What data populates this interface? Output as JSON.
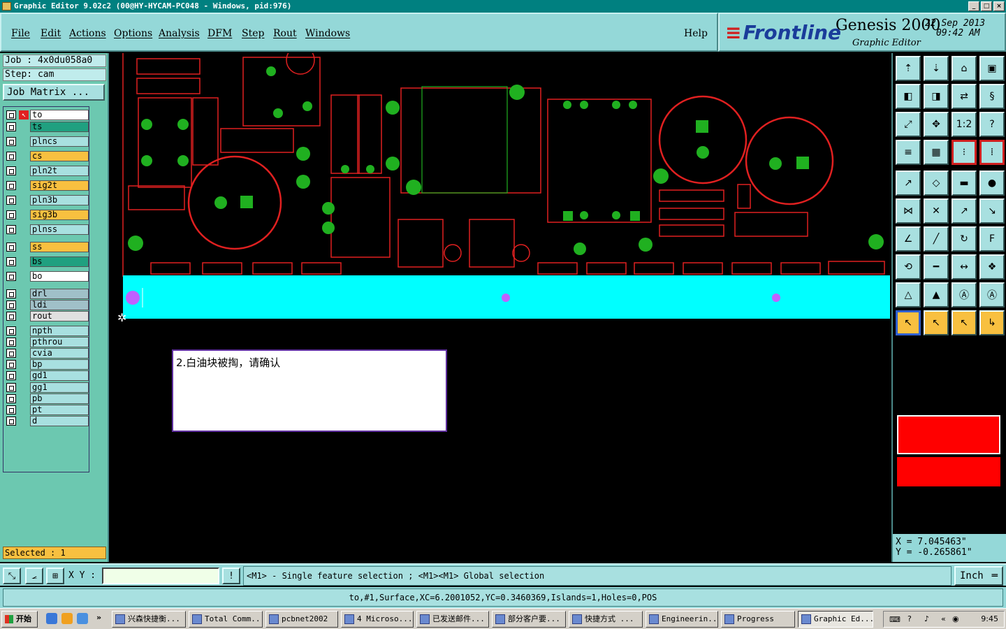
{
  "window": {
    "title": "Graphic Editor 9.02c2 (00@HY-HYCAM-PC048 - Windows, pid:976)"
  },
  "menu": {
    "items": [
      "File",
      "Edit",
      "Actions",
      "Options",
      "Analysis",
      "DFM",
      "Step",
      "Rout",
      "Windows"
    ],
    "help": "Help"
  },
  "brand": {
    "name": "Frontline",
    "product": "Genesis 2000",
    "subtitle": "Graphic Editor",
    "date": "22 Sep 2013",
    "time": "09:42 AM"
  },
  "job": {
    "job_line": "Job : 4x0du058a0",
    "step_line": "Step: cam",
    "matrix_button": "Job Matrix ..."
  },
  "layers": [
    {
      "name": "to",
      "color": "#ffffff",
      "active": true
    },
    {
      "name": "ts",
      "color": "#20a080"
    },
    {
      "name": "plncs",
      "color": "#a8e0e0"
    },
    {
      "name": "cs",
      "color": "#f8c040"
    },
    {
      "name": "pln2t",
      "color": "#a8e0e0"
    },
    {
      "name": "sig2t",
      "color": "#f8c040"
    },
    {
      "name": "pln3b",
      "color": "#a8e0e0"
    },
    {
      "name": "sig3b",
      "color": "#f8c040"
    },
    {
      "name": "plnss",
      "color": "#a8e0e0"
    },
    {
      "name": "ss",
      "color": "#f8c040"
    },
    {
      "name": "bs",
      "color": "#20a080"
    },
    {
      "name": "bo",
      "color": "#ffffff"
    },
    {
      "name": "drl",
      "color": "#a0c0c8"
    },
    {
      "name": "ldi",
      "color": "#a0c0c8"
    },
    {
      "name": "rout",
      "color": "#e0e0e0"
    },
    {
      "name": "npth",
      "color": "#a8e0e0"
    },
    {
      "name": "pthrou",
      "color": "#a8e0e0"
    },
    {
      "name": "cvia",
      "color": "#a8e0e0"
    },
    {
      "name": "bp",
      "color": "#a8e0e0"
    },
    {
      "name": "gd1",
      "color": "#a8e0e0"
    },
    {
      "name": "gg1",
      "color": "#a8e0e0"
    },
    {
      "name": "pb",
      "color": "#a8e0e0"
    },
    {
      "name": "pt",
      "color": "#a8e0e0"
    },
    {
      "name": "d",
      "color": "#a8e0e0"
    }
  ],
  "selected_text": "Selected : 1",
  "canvas": {
    "note": "2.白油块被掏，请确认"
  },
  "coords": {
    "x": "X = 7.045463\"",
    "y": "Y = -0.265861\""
  },
  "status": {
    "xy_label": "X Y :",
    "xy_value": "",
    "message": "<M1> - Single feature selection ; <M1><M1> Global selection",
    "unit": "Inch",
    "info": "to,#1,Surface,XC=6.2001052,YC=0.3460369,Islands=1,Holes=0,POS"
  },
  "taskbar": {
    "start": "开始",
    "tasks": [
      "兴森快捷衡...",
      "Total Comm...",
      "pcbnet2002",
      "4 Microso...",
      "已发送邮件...",
      "部分客户要...",
      "快捷方式 ...",
      "Engineerin...",
      "Progress",
      "Graphic Ed..."
    ],
    "clock": "9:45"
  },
  "colors": {
    "panel": "#94d8d8",
    "canvas": "#000000",
    "feature_red": "#e02020",
    "pad_green": "#20b020",
    "highlight": "#00ffff",
    "drill": "#c060ff"
  }
}
